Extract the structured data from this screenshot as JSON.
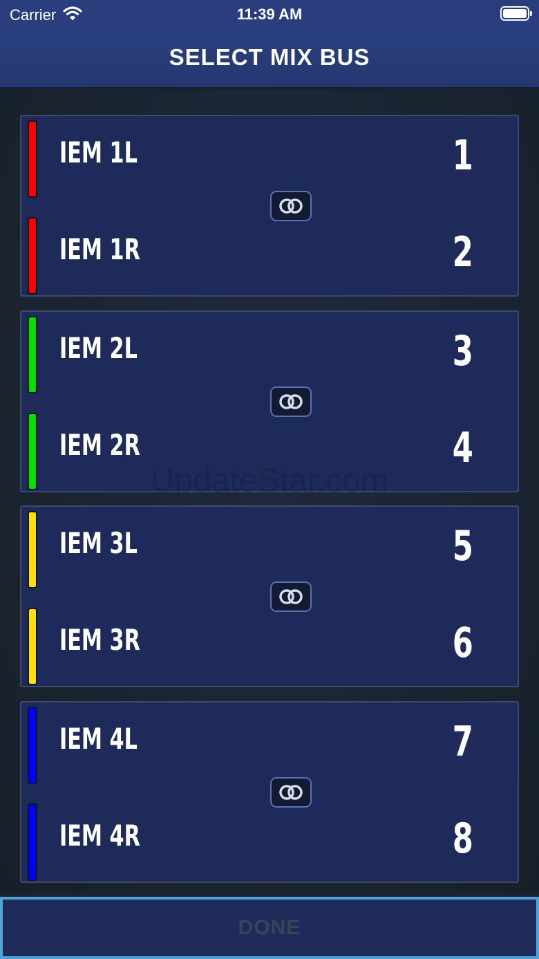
{
  "status_bar": {
    "carrier": "Carrier",
    "time": "11:39 AM",
    "wifi_icon": "wifi-icon",
    "battery_icon": "battery-icon"
  },
  "header": {
    "title": "SELECT MIX BUS"
  },
  "pairs": [
    {
      "color": "#ff0000",
      "link_icon": "link-icon",
      "buses": [
        {
          "label": "IEM 1L",
          "number": "1"
        },
        {
          "label": "IEM 1R",
          "number": "2"
        }
      ]
    },
    {
      "color": "#00e000",
      "link_icon": "link-icon",
      "buses": [
        {
          "label": "IEM 2L",
          "number": "3"
        },
        {
          "label": "IEM 2R",
          "number": "4"
        }
      ]
    },
    {
      "color": "#ffe000",
      "link_icon": "link-icon",
      "buses": [
        {
          "label": "IEM 3L",
          "number": "5"
        },
        {
          "label": "IEM 3R",
          "number": "6"
        }
      ]
    },
    {
      "color": "#0000ff",
      "link_icon": "link-icon",
      "buses": [
        {
          "label": "IEM 4L",
          "number": "7"
        },
        {
          "label": "IEM 4R",
          "number": "8"
        }
      ]
    }
  ],
  "footer": {
    "done_label": "DONE"
  },
  "watermark": "UpdateStar.com"
}
